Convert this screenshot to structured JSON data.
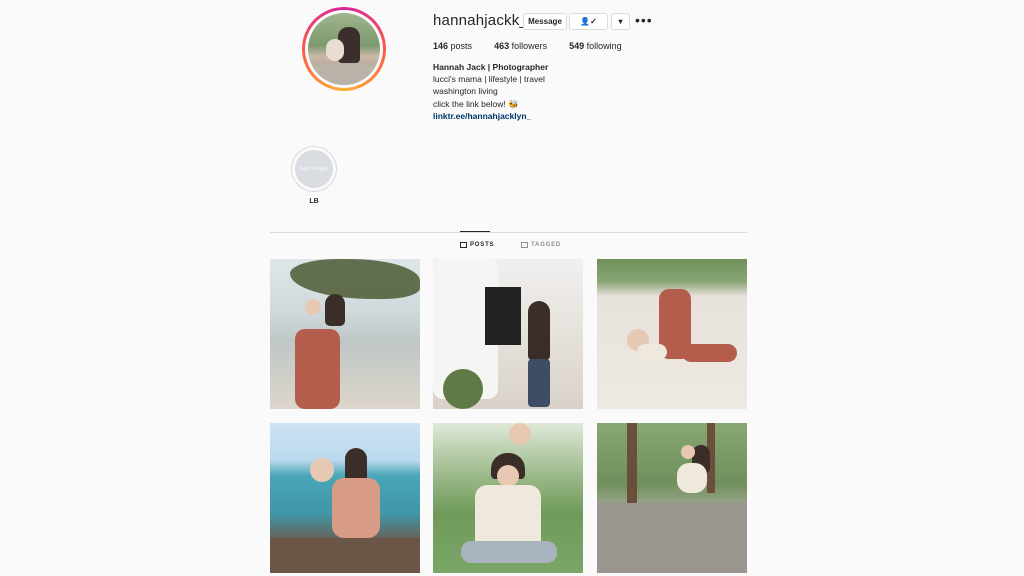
{
  "profile": {
    "username": "hannahjackk_",
    "message_label": "Message",
    "follow_label": "👤✓",
    "caret_label": "▾",
    "more_label": "•••",
    "stats": {
      "posts_count": "146",
      "posts_label": "posts",
      "followers_count": "463",
      "followers_label": "followers",
      "following_count": "549",
      "following_label": "following"
    },
    "bio": {
      "name": "Hannah Jack | Photographer",
      "line1": "lucci's mama | lifestyle | travel",
      "line2": "washington living",
      "line3": "click the link below! 🐝",
      "link": "linktr.ee/hannahjacklyn_"
    }
  },
  "highlights": [
    {
      "label": "LB",
      "cover_text": "light bright"
    }
  ],
  "tabs": {
    "posts_label": "POSTS",
    "tagged_label": "TAGGED"
  },
  "colors": {
    "accent_link": "#00376b",
    "background": "#fafafa",
    "divider": "#dbdbdb",
    "story_ring": [
      "#d6249f",
      "#fd5949",
      "#fdb035"
    ]
  },
  "icons": {
    "more": "more-horizontal-icon",
    "posts_tab": "grid-icon",
    "tagged_tab": "tagged-icon",
    "follow": "user-check-icon"
  }
}
